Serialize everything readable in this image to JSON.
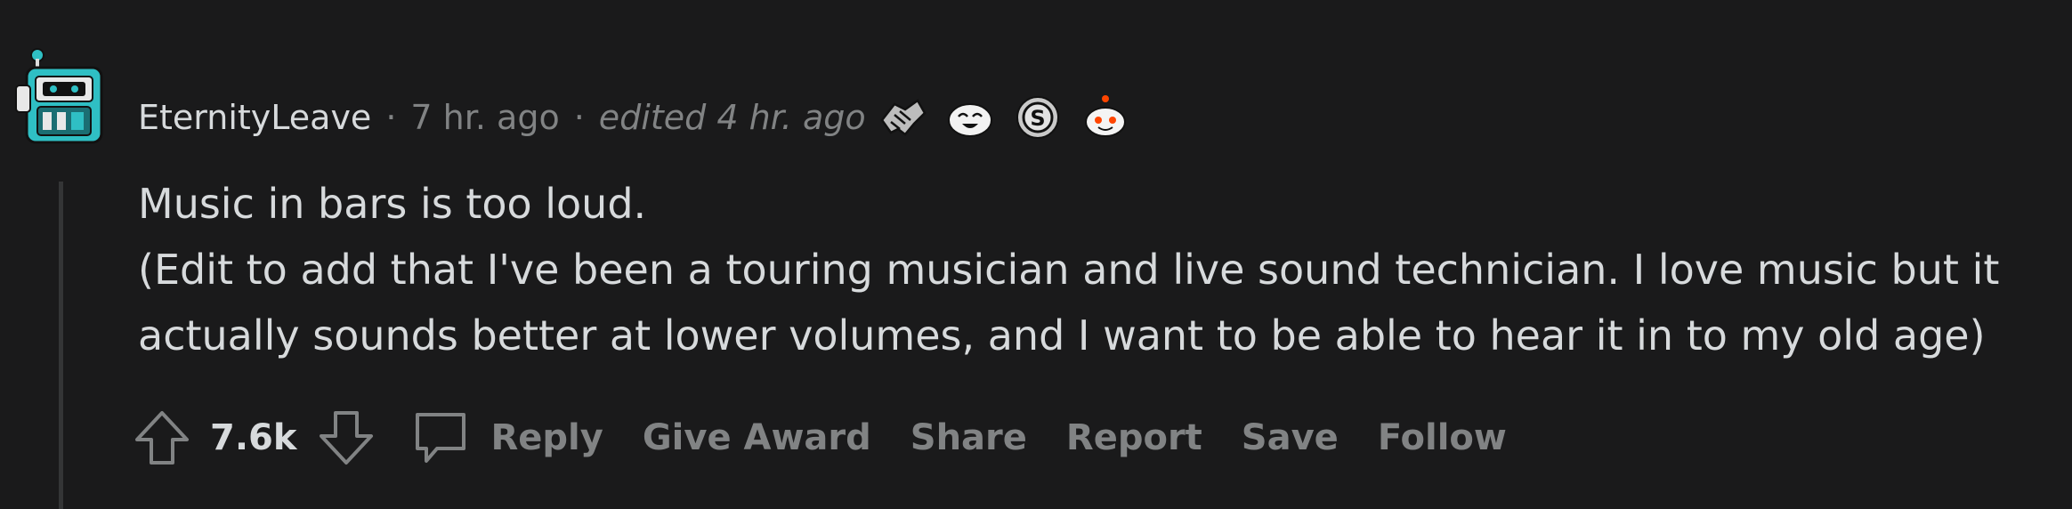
{
  "comment": {
    "username": "EternityLeave",
    "time": "7 hr. ago",
    "edited": "edited 4 hr. ago",
    "separator": "·",
    "awards": [
      "handshake-award-icon",
      "laughing-face-award-icon",
      "silver-award-icon",
      "reddit-snoo-award-icon"
    ],
    "body_lines": [
      "Music in bars is too loud.",
      "(Edit to add that I've been a touring musician and live sound technician. I love music but it actually sounds better at lower volumes, and I want to be able to hear it in to my old age)"
    ],
    "score": "7.6k"
  },
  "actions": {
    "reply": "Reply",
    "give_award": "Give Award",
    "share": "Share",
    "report": "Report",
    "save": "Save",
    "follow": "Follow"
  },
  "colors": {
    "background": "#1a1a1b",
    "text": "#d7dadc",
    "muted": "#818384",
    "avatar_accent": "#2fbfc4"
  }
}
